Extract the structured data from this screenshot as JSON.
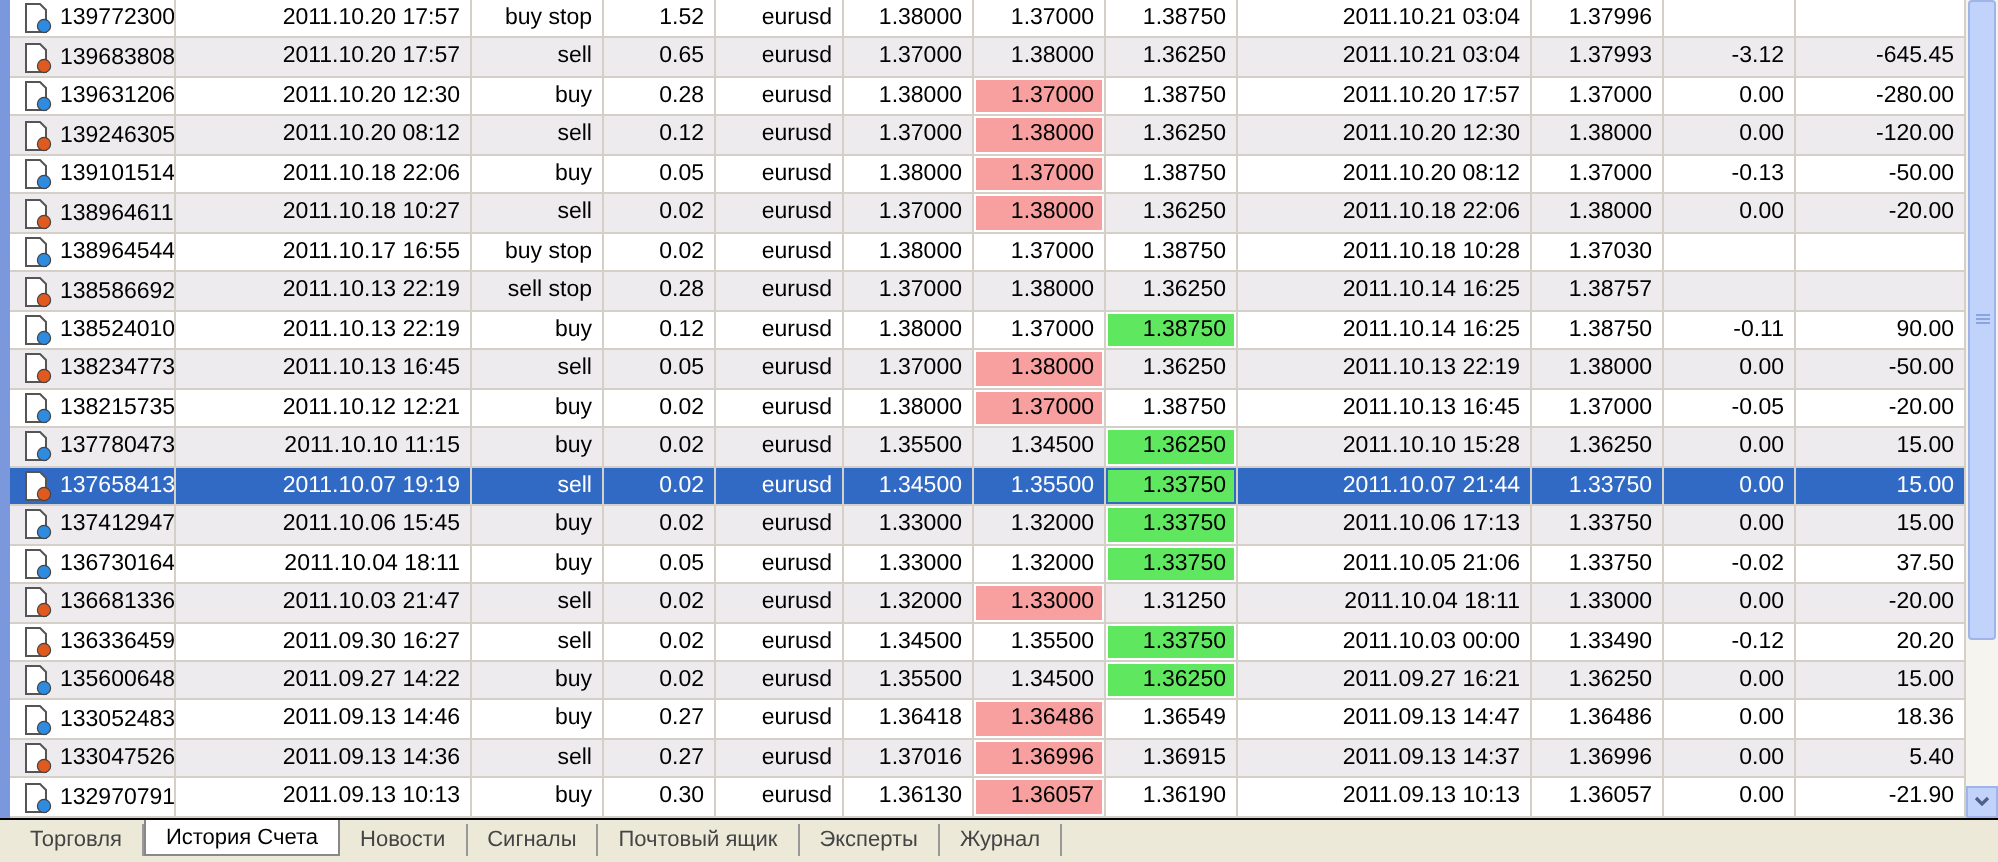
{
  "rows": [
    {
      "kind": "buy",
      "selected": false,
      "sl_hit": false,
      "tp_hit": false,
      "cells": [
        "139772300",
        "2011.10.20 17:57",
        "buy stop",
        "1.52",
        "eurusd",
        "1.38000",
        "1.37000",
        "1.38750",
        "2011.10.21 03:04",
        "1.37996"
      ]
    },
    {
      "kind": "sell",
      "selected": false,
      "sl_hit": false,
      "tp_hit": false,
      "cells": [
        "139683808",
        "2011.10.20 17:57",
        "sell",
        "0.65",
        "eurusd",
        "1.37000",
        "1.38000",
        "1.36250",
        "2011.10.21 03:04",
        "1.37993",
        "-3.12",
        "-645.45"
      ]
    },
    {
      "kind": "buy",
      "selected": false,
      "sl_hit": true,
      "tp_hit": false,
      "cells": [
        "139631206",
        "2011.10.20 12:30",
        "buy",
        "0.28",
        "eurusd",
        "1.38000",
        "1.37000",
        "1.38750",
        "2011.10.20 17:57",
        "1.37000",
        "0.00",
        "-280.00"
      ]
    },
    {
      "kind": "sell",
      "selected": false,
      "sl_hit": true,
      "tp_hit": false,
      "cells": [
        "139246305",
        "2011.10.20 08:12",
        "sell",
        "0.12",
        "eurusd",
        "1.37000",
        "1.38000",
        "1.36250",
        "2011.10.20 12:30",
        "1.38000",
        "0.00",
        "-120.00"
      ]
    },
    {
      "kind": "buy",
      "selected": false,
      "sl_hit": true,
      "tp_hit": false,
      "cells": [
        "139101514",
        "2011.10.18 22:06",
        "buy",
        "0.05",
        "eurusd",
        "1.38000",
        "1.37000",
        "1.38750",
        "2011.10.20 08:12",
        "1.37000",
        "-0.13",
        "-50.00"
      ]
    },
    {
      "kind": "sell",
      "selected": false,
      "sl_hit": true,
      "tp_hit": false,
      "cells": [
        "138964611",
        "2011.10.18 10:27",
        "sell",
        "0.02",
        "eurusd",
        "1.37000",
        "1.38000",
        "1.36250",
        "2011.10.18 22:06",
        "1.38000",
        "0.00",
        "-20.00"
      ]
    },
    {
      "kind": "buy",
      "selected": false,
      "sl_hit": false,
      "tp_hit": false,
      "cells": [
        "138964544",
        "2011.10.17 16:55",
        "buy stop",
        "0.02",
        "eurusd",
        "1.38000",
        "1.37000",
        "1.38750",
        "2011.10.18 10:28",
        "1.37030"
      ]
    },
    {
      "kind": "sell",
      "selected": false,
      "sl_hit": false,
      "tp_hit": false,
      "cells": [
        "138586692",
        "2011.10.13 22:19",
        "sell stop",
        "0.28",
        "eurusd",
        "1.37000",
        "1.38000",
        "1.36250",
        "2011.10.14 16:25",
        "1.38757"
      ]
    },
    {
      "kind": "buy",
      "selected": false,
      "sl_hit": false,
      "tp_hit": true,
      "cells": [
        "138524010",
        "2011.10.13 22:19",
        "buy",
        "0.12",
        "eurusd",
        "1.38000",
        "1.37000",
        "1.38750",
        "2011.10.14 16:25",
        "1.38750",
        "-0.11",
        "90.00"
      ]
    },
    {
      "kind": "sell",
      "selected": false,
      "sl_hit": true,
      "tp_hit": false,
      "cells": [
        "138234773",
        "2011.10.13 16:45",
        "sell",
        "0.05",
        "eurusd",
        "1.37000",
        "1.38000",
        "1.36250",
        "2011.10.13 22:19",
        "1.38000",
        "0.00",
        "-50.00"
      ]
    },
    {
      "kind": "buy",
      "selected": false,
      "sl_hit": true,
      "tp_hit": false,
      "cells": [
        "138215735",
        "2011.10.12 12:21",
        "buy",
        "0.02",
        "eurusd",
        "1.38000",
        "1.37000",
        "1.38750",
        "2011.10.13 16:45",
        "1.37000",
        "-0.05",
        "-20.00"
      ]
    },
    {
      "kind": "buy",
      "selected": false,
      "sl_hit": false,
      "tp_hit": true,
      "cells": [
        "137780473",
        "2011.10.10 11:15",
        "buy",
        "0.02",
        "eurusd",
        "1.35500",
        "1.34500",
        "1.36250",
        "2011.10.10 15:28",
        "1.36250",
        "0.00",
        "15.00"
      ]
    },
    {
      "kind": "sell",
      "selected": true,
      "sl_hit": false,
      "tp_hit": true,
      "cells": [
        "137658413",
        "2011.10.07 19:19",
        "sell",
        "0.02",
        "eurusd",
        "1.34500",
        "1.35500",
        "1.33750",
        "2011.10.07 21:44",
        "1.33750",
        "0.00",
        "15.00"
      ]
    },
    {
      "kind": "buy",
      "selected": false,
      "sl_hit": false,
      "tp_hit": true,
      "cells": [
        "137412947",
        "2011.10.06 15:45",
        "buy",
        "0.02",
        "eurusd",
        "1.33000",
        "1.32000",
        "1.33750",
        "2011.10.06 17:13",
        "1.33750",
        "0.00",
        "15.00"
      ]
    },
    {
      "kind": "buy",
      "selected": false,
      "sl_hit": false,
      "tp_hit": true,
      "cells": [
        "136730164",
        "2011.10.04 18:11",
        "buy",
        "0.05",
        "eurusd",
        "1.33000",
        "1.32000",
        "1.33750",
        "2011.10.05 21:06",
        "1.33750",
        "-0.02",
        "37.50"
      ]
    },
    {
      "kind": "sell",
      "selected": false,
      "sl_hit": true,
      "tp_hit": false,
      "cells": [
        "136681336",
        "2011.10.03 21:47",
        "sell",
        "0.02",
        "eurusd",
        "1.32000",
        "1.33000",
        "1.31250",
        "2011.10.04 18:11",
        "1.33000",
        "0.00",
        "-20.00"
      ]
    },
    {
      "kind": "sell",
      "selected": false,
      "sl_hit": false,
      "tp_hit": true,
      "cells": [
        "136336459",
        "2011.09.30 16:27",
        "sell",
        "0.02",
        "eurusd",
        "1.34500",
        "1.35500",
        "1.33750",
        "2011.10.03 00:00",
        "1.33490",
        "-0.12",
        "20.20"
      ]
    },
    {
      "kind": "buy",
      "selected": false,
      "sl_hit": false,
      "tp_hit": true,
      "cells": [
        "135600648",
        "2011.09.27 14:22",
        "buy",
        "0.02",
        "eurusd",
        "1.35500",
        "1.34500",
        "1.36250",
        "2011.09.27 16:21",
        "1.36250",
        "0.00",
        "15.00"
      ]
    },
    {
      "kind": "buy",
      "selected": false,
      "sl_hit": true,
      "tp_hit": false,
      "cells": [
        "133052483",
        "2011.09.13 14:46",
        "buy",
        "0.27",
        "eurusd",
        "1.36418",
        "1.36486",
        "1.36549",
        "2011.09.13 14:47",
        "1.36486",
        "0.00",
        "18.36"
      ]
    },
    {
      "kind": "sell",
      "selected": false,
      "sl_hit": true,
      "tp_hit": false,
      "cells": [
        "133047526",
        "2011.09.13 14:36",
        "sell",
        "0.27",
        "eurusd",
        "1.37016",
        "1.36996",
        "1.36915",
        "2011.09.13 14:37",
        "1.36996",
        "0.00",
        "5.40"
      ]
    },
    {
      "kind": "buy",
      "selected": false,
      "sl_hit": true,
      "tp_hit": false,
      "cells": [
        "132970791",
        "2011.09.13 10:13",
        "buy",
        "0.30",
        "eurusd",
        "1.36130",
        "1.36057",
        "1.36190",
        "2011.09.13 10:13",
        "1.36057",
        "0.00",
        "-21.90"
      ]
    }
  ],
  "tabs": [
    {
      "label": "Торговля",
      "selected": false
    },
    {
      "label": "История Счета",
      "selected": true
    },
    {
      "label": "Новости",
      "selected": false
    },
    {
      "label": "Сигналы",
      "selected": false
    },
    {
      "label": "Почтовый ящик",
      "selected": false
    },
    {
      "label": "Эксперты",
      "selected": false
    },
    {
      "label": "Журнал",
      "selected": false
    }
  ]
}
